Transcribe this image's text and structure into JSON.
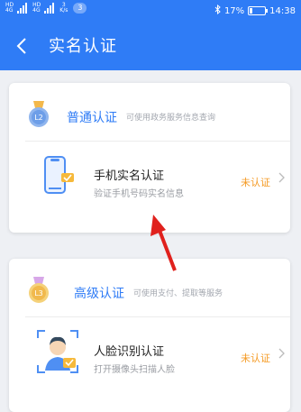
{
  "status_bar": {
    "hd1": "HD",
    "hd2": "HD",
    "net1": "4G",
    "net2": "4G",
    "speed_value": "3",
    "speed_unit": "K/s",
    "notification_count": "3",
    "battery": "17%",
    "time": "14:38"
  },
  "header": {
    "back_icon": "chevron-left-icon",
    "title": "实名认证"
  },
  "levels": [
    {
      "badge_icon": "medal-l2-icon",
      "badge_text": "L2",
      "title": "普通认证",
      "desc": "可使用政务服务信息查询",
      "item": {
        "icon": "phone-verify-icon",
        "name": "手机实名认证",
        "desc": "验证手机号码实名信息",
        "status": "未认证"
      }
    },
    {
      "badge_icon": "medal-l3-icon",
      "badge_text": "L3",
      "title": "高级认证",
      "desc": "可使用支付、提取等服务",
      "item": {
        "icon": "face-scan-icon",
        "name": "人脸识别认证",
        "desc": "打开摄像头扫描人脸",
        "status": "未认证"
      }
    }
  ],
  "colors": {
    "primary": "#2f7cf6",
    "warning": "#f59a23",
    "annotation": "#e0211d"
  }
}
